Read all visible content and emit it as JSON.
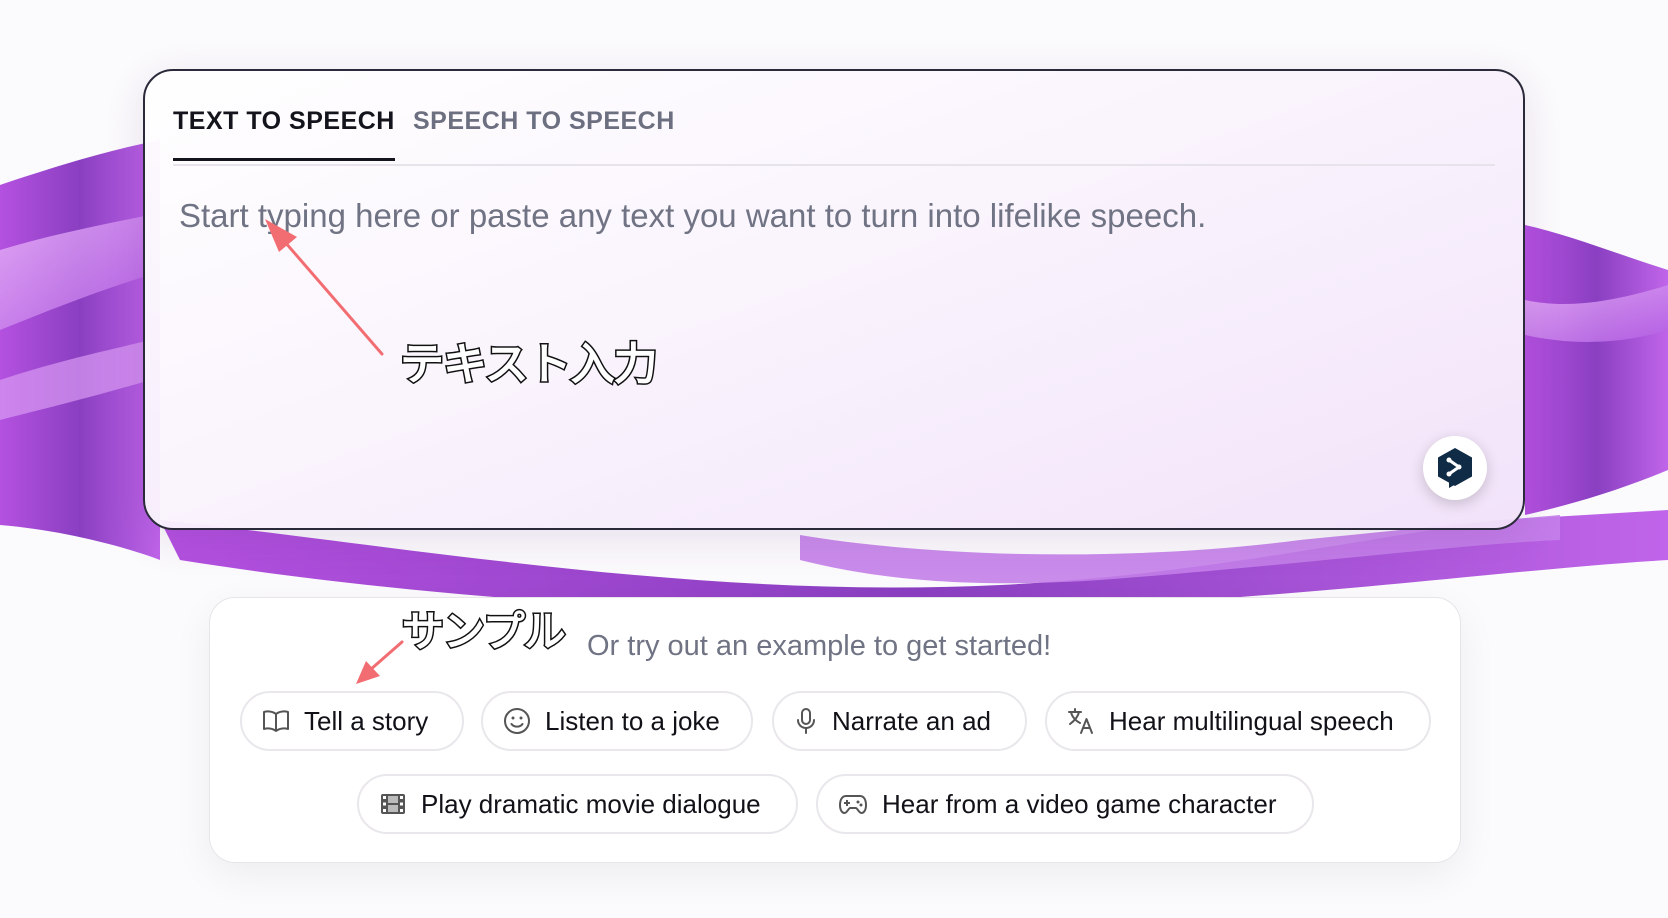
{
  "tabs": [
    {
      "label": "TEXT TO SPEECH",
      "active": true
    },
    {
      "label": "SPEECH TO SPEECH",
      "active": false
    }
  ],
  "editor": {
    "placeholder": "Start typing here or paste any text you want to turn into lifelike speech.",
    "value": ""
  },
  "examples": {
    "heading": "Or try out an example to get started!",
    "chips": [
      {
        "label": "Tell a story",
        "icon": "book-icon"
      },
      {
        "label": "Listen to a joke",
        "icon": "smiley-icon"
      },
      {
        "label": "Narrate an ad",
        "icon": "microphone-icon"
      },
      {
        "label": "Hear multilingual speech",
        "icon": "translate-icon"
      },
      {
        "label": "Play dramatic movie dialogue",
        "icon": "film-icon"
      },
      {
        "label": "Hear from a video game character",
        "icon": "gamepad-icon"
      }
    ]
  },
  "annotations": {
    "text_input": "テキスト入力",
    "sample": "サンプル"
  },
  "colors": {
    "accent_purple": "#a24fd6",
    "annotation_arrow": "#f26d72",
    "logo_navy": "#0f2b46"
  }
}
